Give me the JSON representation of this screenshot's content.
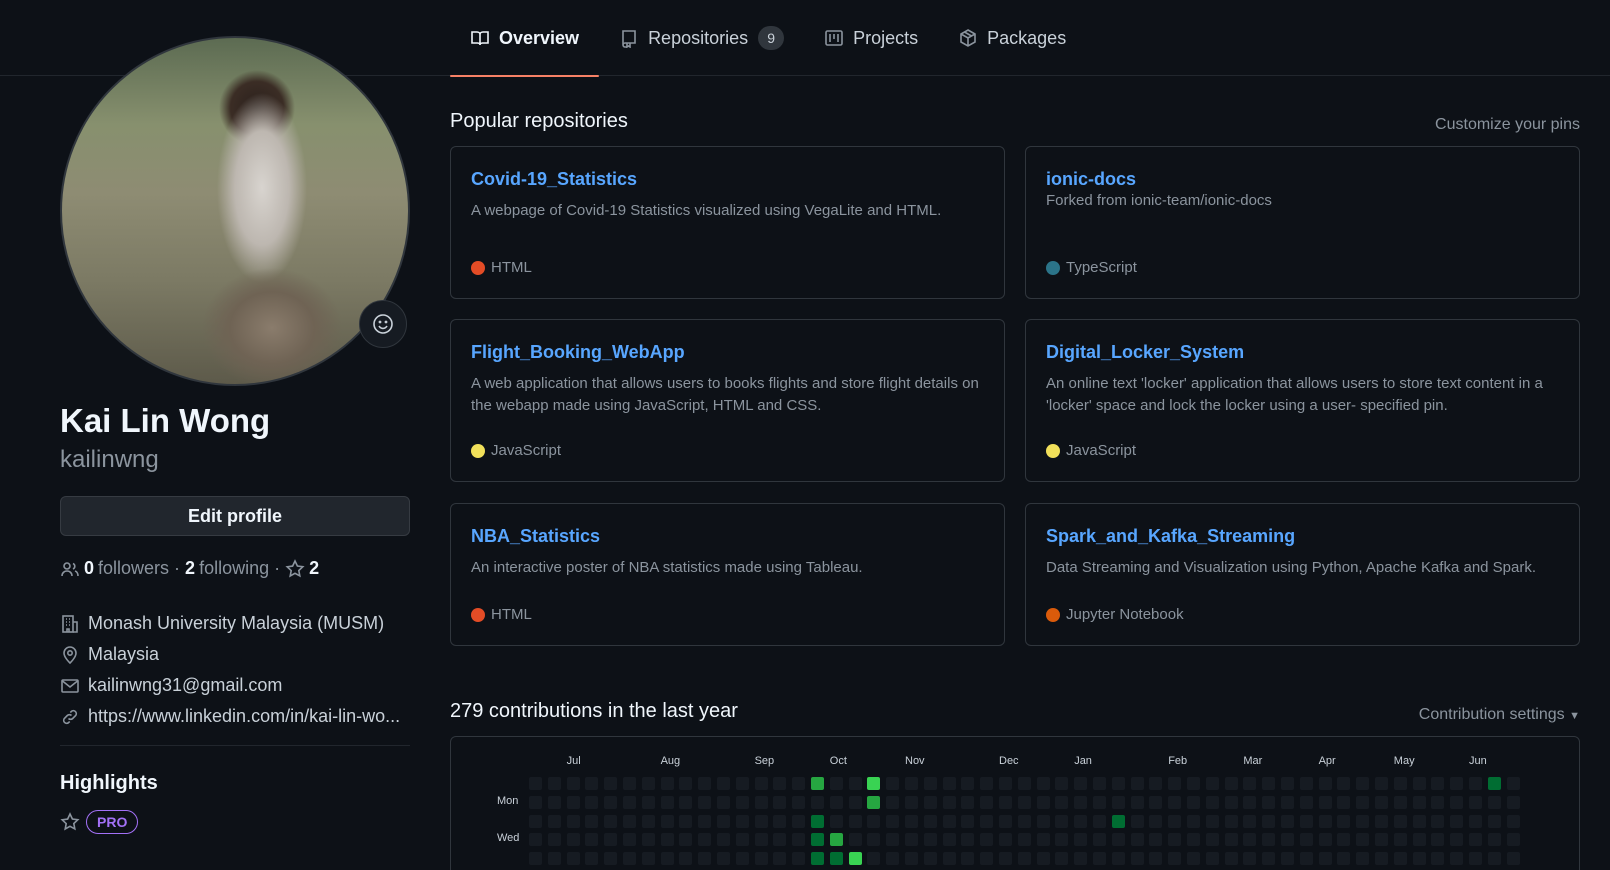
{
  "tabs": [
    {
      "label": "Overview",
      "active": true,
      "icon": "book-icon"
    },
    {
      "label": "Repositories",
      "count": "9",
      "icon": "repo-icon"
    },
    {
      "label": "Projects",
      "icon": "project-icon"
    },
    {
      "label": "Packages",
      "icon": "package-icon"
    }
  ],
  "profile": {
    "fullname": "Kai Lin Wong",
    "username": "kailinwng",
    "edit_label": "Edit profile",
    "followers_count": "0",
    "followers_label": "followers",
    "following_count": "2",
    "following_label": "following",
    "stars_count": "2",
    "org": "Monash University Malaysia (MUSM)",
    "location": "Malaysia",
    "email": "kailinwng31@gmail.com",
    "website": "https://www.linkedin.com/in/kai-lin-wo..."
  },
  "highlights": {
    "title": "Highlights",
    "badge": "PRO"
  },
  "popular": {
    "title": "Popular repositories",
    "customize_label": "Customize your pins",
    "repos": [
      {
        "name": "Covid-19_Statistics",
        "desc": "A webpage of Covid-19 Statistics visualized using VegaLite and HTML.",
        "language": "HTML",
        "color": "#e34c26"
      },
      {
        "name": "ionic-docs",
        "fork": "Forked from ionic-team/ionic-docs",
        "language": "TypeScript",
        "color": "#2b7489"
      },
      {
        "name": "Flight_Booking_WebApp",
        "desc": "A web application that allows users to books flights and store flight details on the webapp made using JavaScript, HTML and CSS.",
        "language": "JavaScript",
        "color": "#f1e05a"
      },
      {
        "name": "Digital_Locker_System",
        "desc": "An online text 'locker' application that allows users to store text content in a 'locker' space and lock the locker using a user- specified pin.",
        "language": "JavaScript",
        "color": "#f1e05a"
      },
      {
        "name": "NBA_Statistics",
        "desc": "An interactive poster of NBA statistics made using Tableau.",
        "language": "HTML",
        "color": "#e34c26"
      },
      {
        "name": "Spark_and_Kafka_Streaming",
        "desc": "Data Streaming and Visualization using Python, Apache Kafka and Spark.",
        "language": "Jupyter Notebook",
        "color": "#DA5B0B"
      }
    ]
  },
  "contributions": {
    "title": "279 contributions in the last year",
    "settings_label": "Contribution settings",
    "months": [
      "Jul",
      "Aug",
      "Sep",
      "Oct",
      "Nov",
      "Dec",
      "Jan",
      "Feb",
      "Mar",
      "Apr",
      "May",
      "Jun"
    ],
    "days": [
      "Mon",
      "Wed"
    ],
    "colors": {
      "empty": "#161b22",
      "l1": "#0e4429",
      "l2": "#006d32",
      "l3": "#26a641",
      "l4": "#39d353"
    }
  }
}
